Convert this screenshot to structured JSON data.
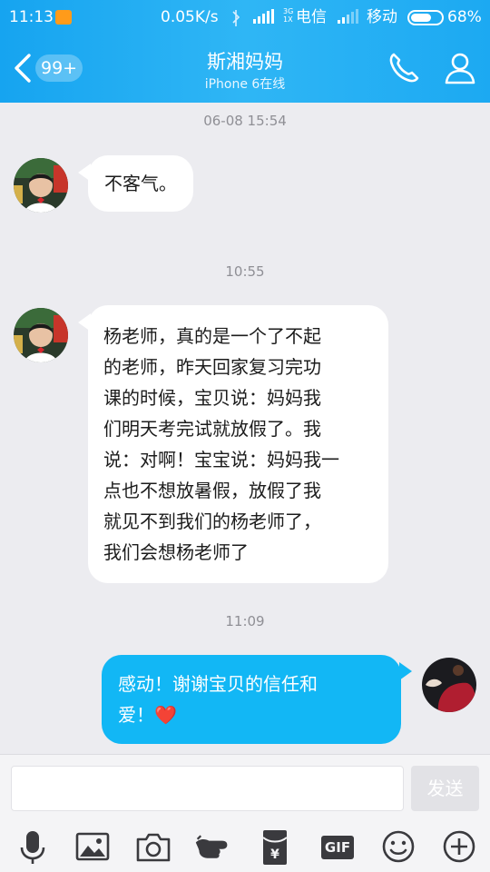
{
  "status_bar": {
    "time": "11:13",
    "network_speed": "0.05K/s",
    "carrier1": "电信",
    "carrier2": "移动",
    "battery": "68%",
    "battery_level": 0.68
  },
  "header": {
    "unread_count": "99+",
    "contact_name": "斯湘妈妈",
    "contact_status": "iPhone 6在线"
  },
  "messages": [
    {
      "type": "timestamp",
      "text": "06-08 15:54"
    },
    {
      "type": "incoming",
      "text": "不客气。"
    },
    {
      "type": "timestamp",
      "text": "10:55"
    },
    {
      "type": "incoming",
      "lines": [
        "杨老师，真的是一个了不起",
        "的老师，昨天回家复习完功",
        "课的时候，宝贝说：妈妈我",
        "们明天考完试就放假了。我",
        "说：对啊！宝宝说：妈妈我一",
        "点也不想放暑假，放假了我",
        "就见不到我们的杨老师了，",
        "我们会想杨老师了"
      ]
    },
    {
      "type": "timestamp",
      "text": "11:09"
    },
    {
      "type": "outgoing",
      "lines": [
        "感动！谢谢宝贝的信任和",
        "爱！❤️"
      ]
    }
  ],
  "input": {
    "placeholder": "",
    "send_label": "发送"
  },
  "toolbar": {
    "icons": [
      "microphone-icon",
      "image-icon",
      "camera-icon",
      "poke-icon",
      "red-packet-icon",
      "gif-icon",
      "emoji-icon",
      "plus-icon"
    ],
    "gif_label": "GIF",
    "red_packet_symbol": "¥"
  },
  "colors": {
    "header_blue": "#1ca9f2",
    "outgoing_bubble": "#12b7f5",
    "background": "#ececf0"
  }
}
